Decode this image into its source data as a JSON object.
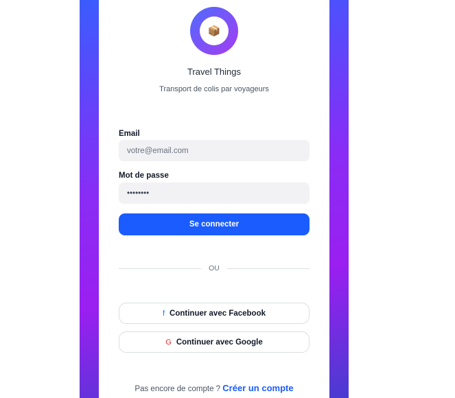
{
  "app": {
    "title": "Travel Things",
    "subtitle": "Transport de colis par voyageurs",
    "logo_icon": "package-icon",
    "logo_glyph": "📦"
  },
  "form": {
    "email_label": "Email",
    "email_placeholder": "votre@email.com",
    "email_value": "",
    "password_label": "Mot de passe",
    "password_value": "password",
    "submit_label": "Se connecter"
  },
  "divider": {
    "text": "OU"
  },
  "social": {
    "facebook_icon": "f",
    "facebook_label": "Continuer avec Facebook",
    "google_icon": "G",
    "google_label": "Continuer avec Google"
  },
  "footer": {
    "prompt": "Pas encore de compte ?",
    "link_label": "Créer un compte"
  },
  "colors": {
    "accent": "#1a5cff",
    "facebook": "#1877f2",
    "google": "#e02d2d",
    "gradient_start": "#3b5cff",
    "gradient_end": "#9a1ff0"
  }
}
